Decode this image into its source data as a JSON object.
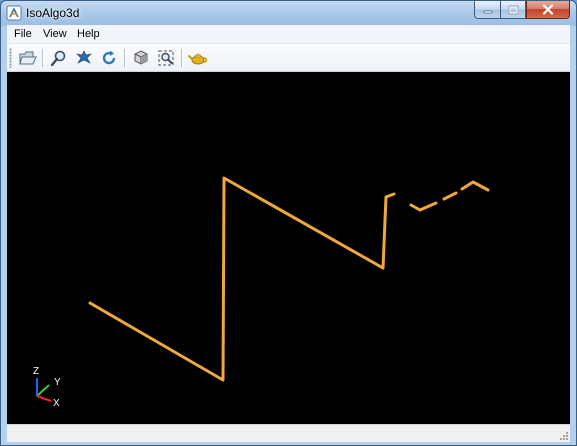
{
  "window": {
    "title": "IsoAlgo3d"
  },
  "menu": {
    "items": [
      "File",
      "View",
      "Help"
    ]
  },
  "toolbar": {
    "buttons": [
      {
        "icon": "open-file-icon"
      },
      {
        "icon": "zoom-icon"
      },
      {
        "icon": "pan-icon"
      },
      {
        "icon": "rotate-icon"
      },
      {
        "icon": "view-cube-icon"
      },
      {
        "icon": "fit-all-icon"
      },
      {
        "icon": "teapot-icon"
      }
    ]
  },
  "viewport": {
    "background": "#000000",
    "pipe_color": "#f0a83a",
    "axes": {
      "z_label": "Z",
      "y_label": "Y",
      "x_label": "X"
    }
  },
  "colors": {
    "axis_x": "#ff2020",
    "axis_y": "#30d030",
    "axis_z": "#2060ff"
  }
}
